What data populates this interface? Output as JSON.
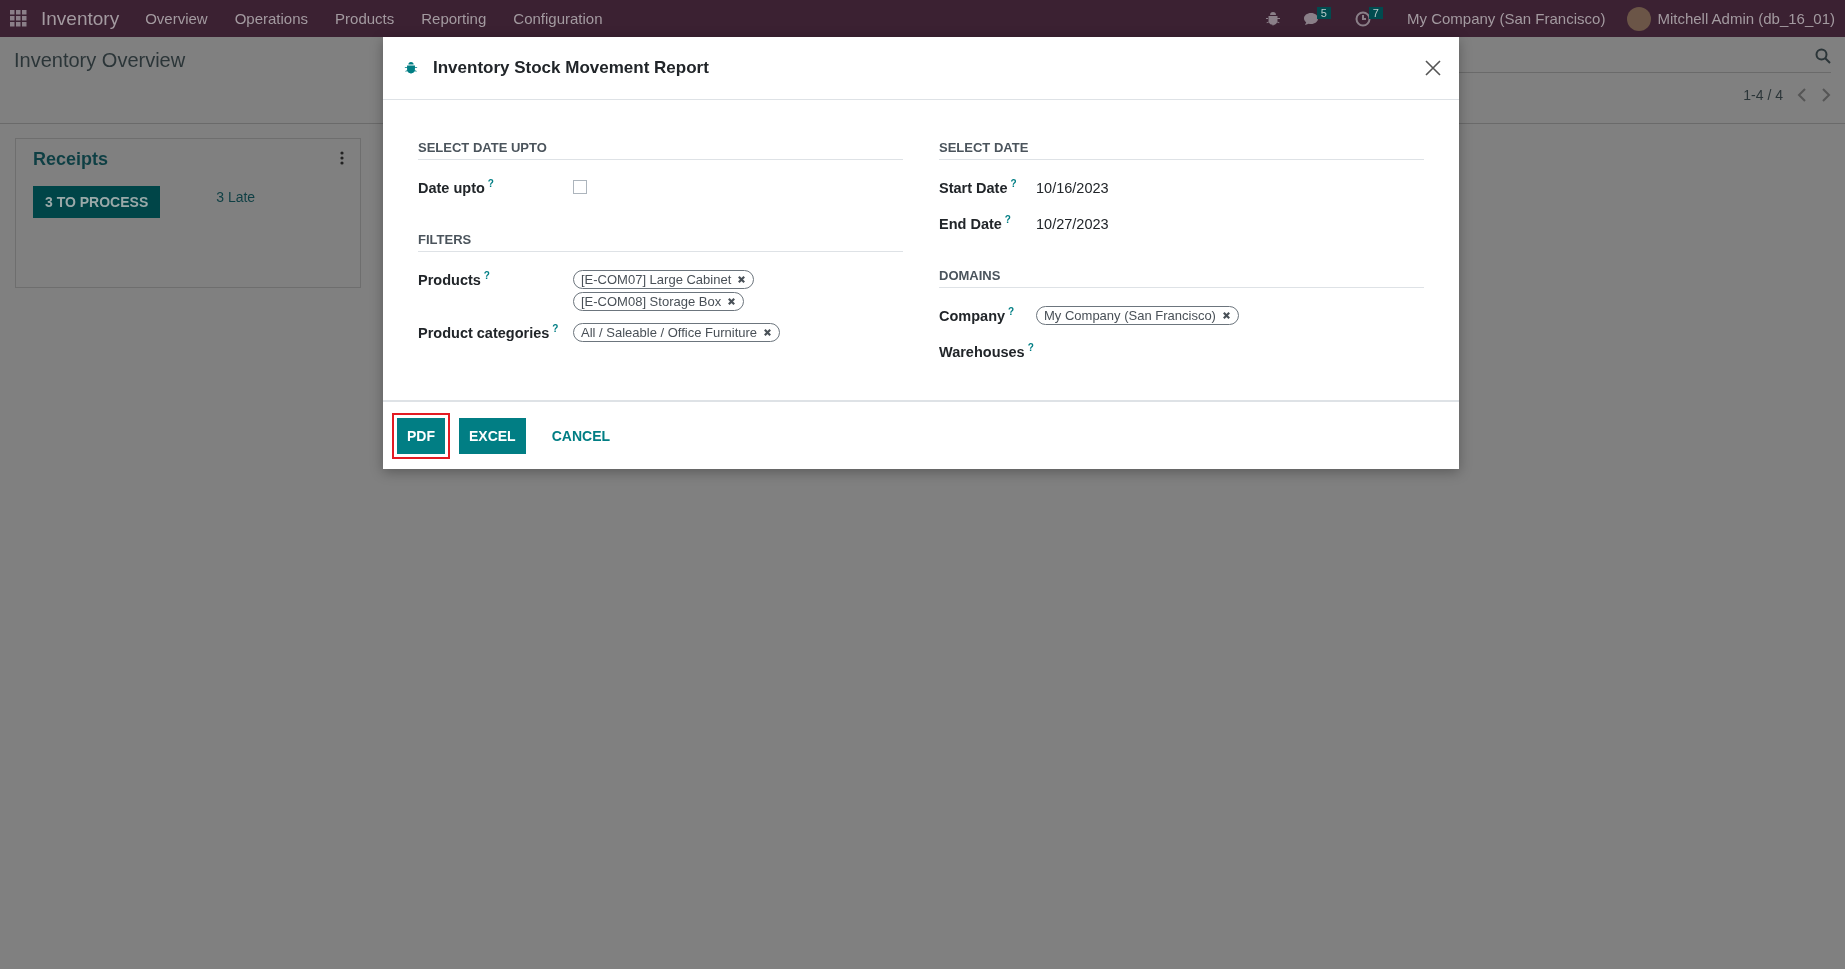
{
  "navbar": {
    "app_name": "Inventory",
    "menu": [
      "Overview",
      "Operations",
      "Products",
      "Reporting",
      "Configuration"
    ],
    "messages_badge": "5",
    "activities_badge": "7",
    "company": "My Company (San Francisco)",
    "user": "Mitchell Admin (db_16_01)"
  },
  "control_panel": {
    "title": "Inventory Overview",
    "pager": "1-4 / 4"
  },
  "cards": [
    {
      "title": "Receipts",
      "process_button": "3 TO PROCESS",
      "late": "3 Late"
    }
  ],
  "dialog": {
    "title": "Inventory Stock Movement Report",
    "columns": [
      {
        "sections": [
          {
            "title": "SELECT DATE UPTO",
            "fields": [
              {
                "label": "Date upto",
                "help": "?",
                "kind": "checkbox",
                "checked": false
              }
            ]
          },
          {
            "title": "FILTERS",
            "fields": [
              {
                "label": "Products",
                "help": "?",
                "kind": "tags",
                "tags": [
                  "[E-COM07] Large Cabinet",
                  "[E-COM08] Storage Box"
                ]
              },
              {
                "label": "Product categories",
                "help": "?",
                "kind": "tags",
                "tags": [
                  "All / Saleable / Office Furniture"
                ]
              }
            ]
          }
        ]
      },
      {
        "sections": [
          {
            "title": "SELECT DATE",
            "fields": [
              {
                "label": "Start Date",
                "help": "?",
                "kind": "text",
                "value": "10/16/2023"
              },
              {
                "label": "End Date",
                "help": "?",
                "kind": "text",
                "value": "10/27/2023"
              }
            ]
          },
          {
            "title": "DOMAINS",
            "fields": [
              {
                "label": "Company",
                "help": "?",
                "kind": "tags",
                "tags": [
                  "My Company (San Francisco)"
                ]
              },
              {
                "label": "Warehouses",
                "help": "?",
                "kind": "tags"
              }
            ]
          }
        ]
      }
    ],
    "buttons": [
      {
        "label": "PDF",
        "kind": "primary",
        "highlighted": true
      },
      {
        "label": "EXCEL",
        "kind": "primary",
        "highlighted": false
      },
      {
        "label": "CANCEL",
        "kind": "link",
        "highlighted": false
      }
    ]
  }
}
